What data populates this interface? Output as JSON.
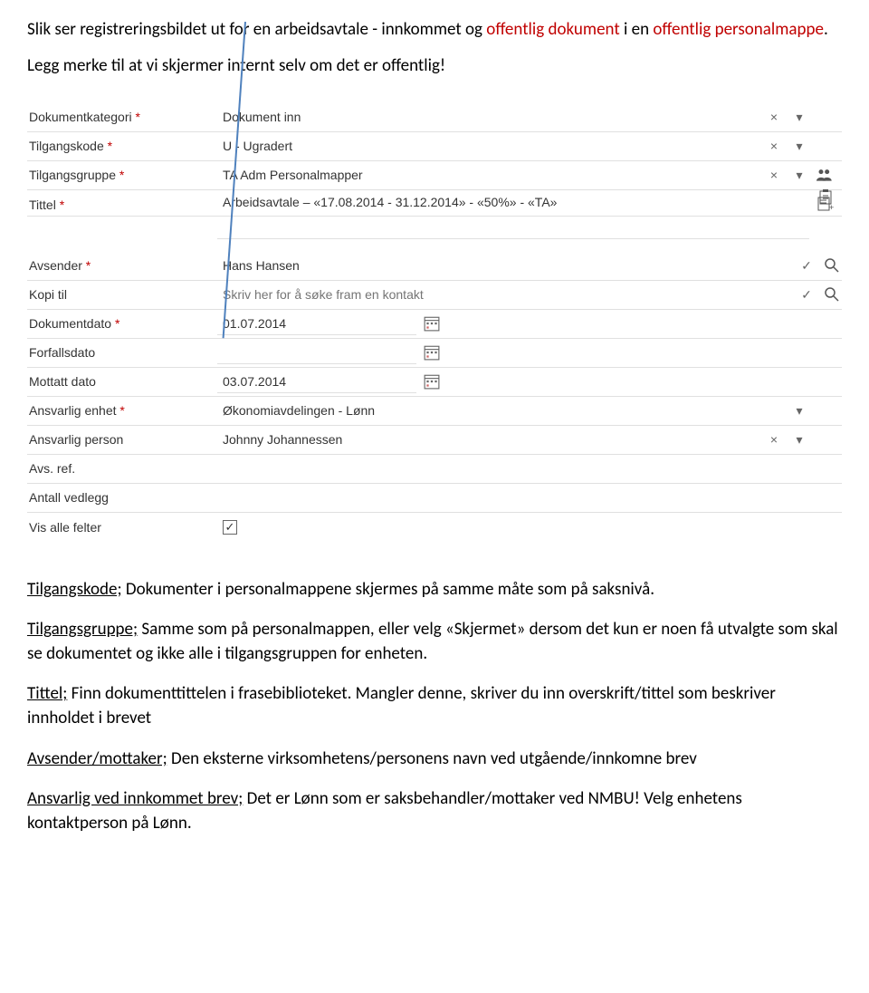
{
  "intro": {
    "part1": "Slik ser registreringsbildet ut for en arbeidsavtale - innkommet og ",
    "red1": "offentlig dokument",
    "part2": " i en ",
    "red2": "offentlig personalmappe",
    "period": "."
  },
  "intro2": "Legg merke til at vi skjermer internt selv om det er offentlig!",
  "form": {
    "labels": {
      "dokumentkategori": "Dokumentkategori",
      "tilgangskode": "Tilgangskode",
      "tilgangsgruppe": "Tilgangsgruppe",
      "tittel": "Tittel",
      "avsender": "Avsender",
      "kopi_til": "Kopi til",
      "dokumentdato": "Dokumentdato",
      "forfallsdato": "Forfallsdato",
      "mottatt_dato": "Mottatt dato",
      "ansvarlig_enhet": "Ansvarlig enhet",
      "ansvarlig_person": "Ansvarlig person",
      "avs_ref": "Avs. ref.",
      "antall_vedlegg": "Antall vedlegg",
      "vis_alle_felter": "Vis alle felter"
    },
    "values": {
      "dokumentkategori": "Dokument inn",
      "tilgangskode": "U - Ugradert",
      "tilgangsgruppe": "TA Adm Personalmapper",
      "tittel": "Arbeidsavtale – «17.08.2014 - 31.12.2014» - «50%» - «TA»",
      "avsender": "Hans Hansen",
      "kopi_til_placeholder": "Skriv her for å søke fram en kontakt",
      "dokumentdato": "01.07.2014",
      "forfallsdato": "",
      "mottatt_dato": "03.07.2014",
      "ansvarlig_enhet": "Økonomiavdelingen - Lønn",
      "ansvarlig_person": "Johnny Johannessen",
      "avs_ref": "",
      "antall_vedlegg": ""
    },
    "vis_alle_checked": "✓"
  },
  "desc": {
    "p1_u": "Tilgangskode;",
    "p1_rest": " Dokumenter i personalmappene skjermes på samme måte som på saksnivå.",
    "p2_u": "Tilgangsgruppe;",
    "p2_rest": " Samme som på personalmappen, eller velg «Skjermet» dersom det kun er noen få utvalgte som skal se dokumentet og ikke alle i tilgangsgruppen for enheten.",
    "p3_u": "Tittel;",
    "p3_rest": " Finn dokumenttittelen i frasebiblioteket. Mangler denne, skriver du inn overskrift/tittel som beskriver innholdet i brevet",
    "p4_u": "Avsender/mottaker;",
    "p4_rest": " Den eksterne virksomhetens/personens navn ved utgående/innkomne brev",
    "p5_u": "Ansvarlig ved innkommet brev;",
    "p5_rest": " Det er Lønn som er saksbehandler/mottaker ved NMBU! Velg enhetens kontaktperson på Lønn."
  }
}
